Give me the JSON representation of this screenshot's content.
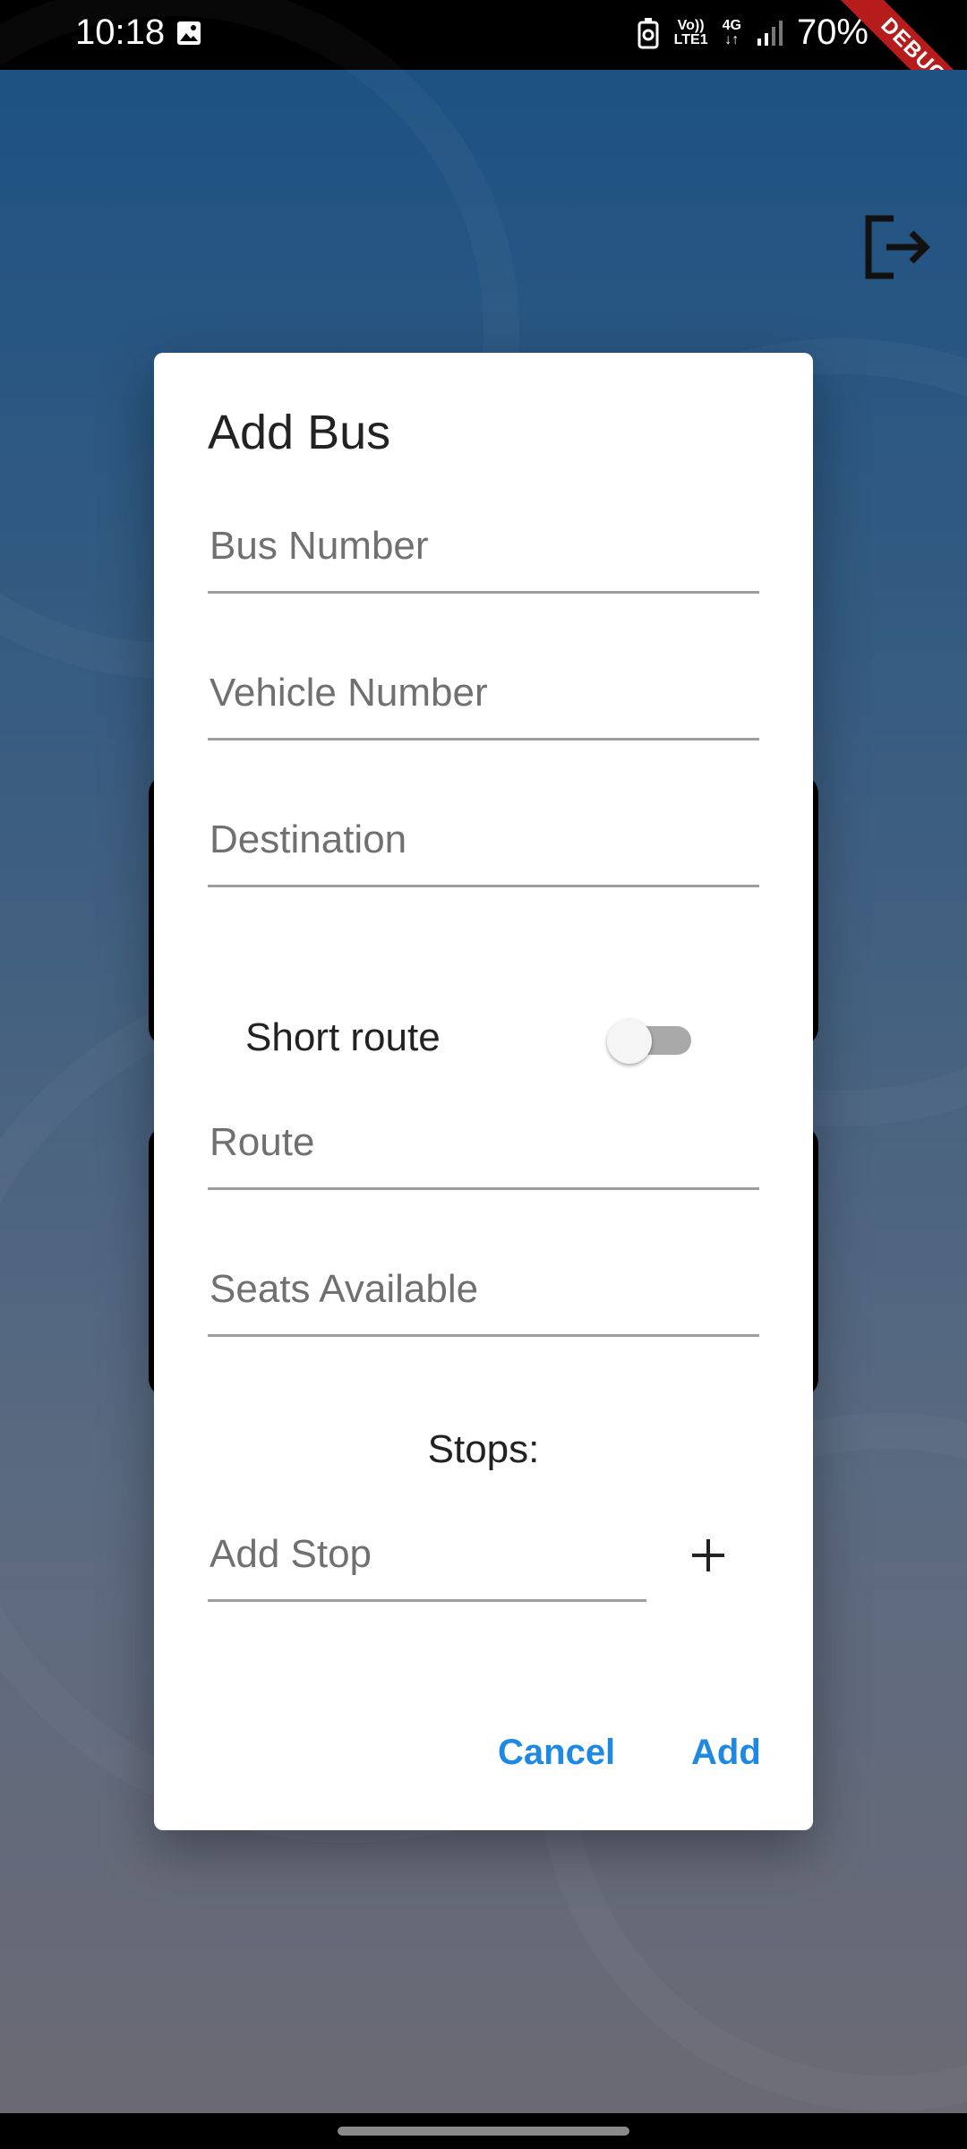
{
  "status_bar": {
    "time": "10:18",
    "volte_top": "Vo))",
    "volte_bottom": "LTE1",
    "network": "4G",
    "battery": "70%",
    "debug_label": "DEBUG"
  },
  "dialog": {
    "title": "Add Bus",
    "fields": {
      "bus_number_placeholder": "Bus Number",
      "vehicle_number_placeholder": "Vehicle Number",
      "destination_placeholder": "Destination",
      "route_placeholder": "Route",
      "seats_placeholder": "Seats Available",
      "add_stop_placeholder": "Add Stop"
    },
    "short_route_label": "Short route",
    "short_route_enabled": false,
    "stops_heading": "Stops:",
    "cancel_label": "Cancel",
    "add_label": "Add"
  },
  "colors": {
    "accent": "#1e88e5",
    "debug_banner": "#b71c1c"
  },
  "icons": {
    "logout": "logout-icon",
    "add_stop": "plus-icon",
    "status_image": "image-icon"
  }
}
